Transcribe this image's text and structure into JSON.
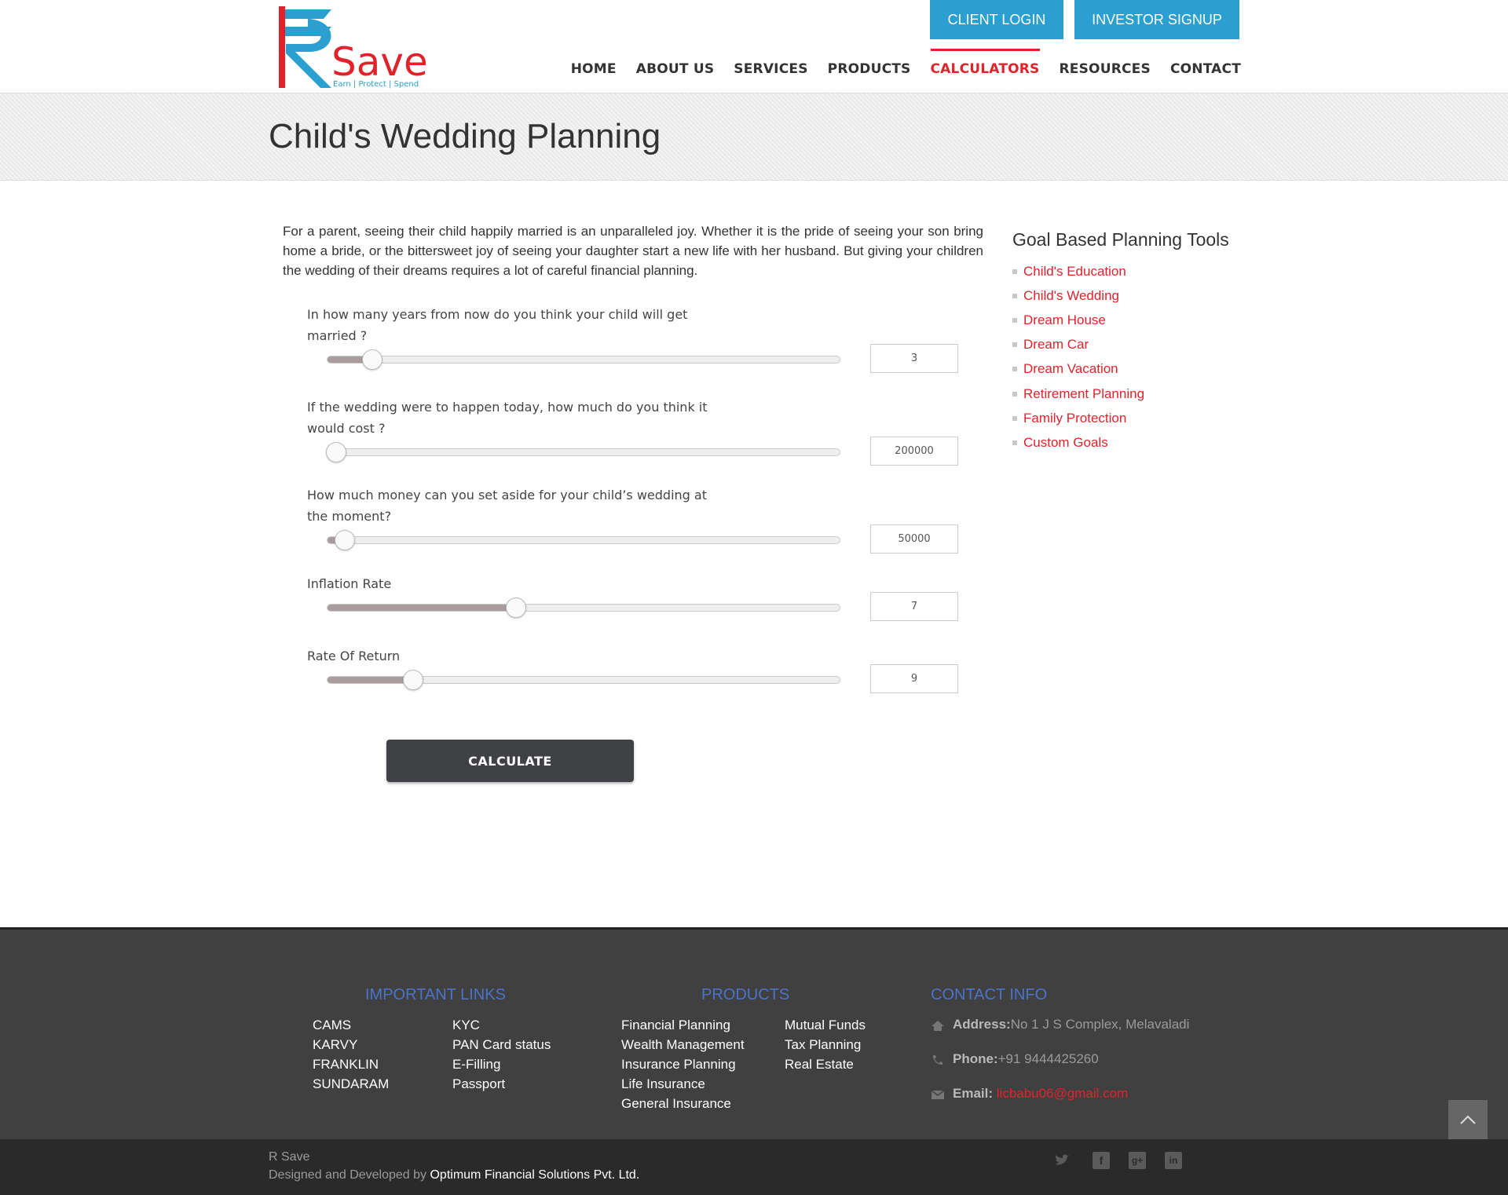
{
  "header": {
    "logo": {
      "text": "Save",
      "tagline": "Earn | Protect | Spend"
    },
    "client_login": "CLIENT LOGIN",
    "investor_signup": "INVESTOR SIGNUP",
    "nav": [
      "HOME",
      "ABOUT US",
      "SERVICES",
      "PRODUCTS",
      "CALCULATORS",
      "RESOURCES",
      "CONTACT"
    ],
    "active_nav": "CALCULATORS",
    "accent_color": "#e0232b",
    "button_color": "#2a9fd0"
  },
  "page_title": "Child's Wedding Planning",
  "intro": "For a parent, seeing their child happily married is an unparalleled joy. Whether it is the pride of seeing your son bring home a bride, or the bittersweet joy of seeing your daughter start a new life with her husband. But giving your children the wedding of their dreams requires a lot of careful financial planning.",
  "calculator": {
    "questions": [
      {
        "label": "In how many years from now do you think your child will get married ?",
        "value": "3",
        "slider_fraction": 0.087
      },
      {
        "label": "If the wedding were to happen today, how much do you think it would cost ?",
        "value": "200000",
        "slider_fraction": 0.017
      },
      {
        "label": "How much money can you set aside for your child’s wedding at the moment?",
        "value": "50000",
        "slider_fraction": 0.034
      },
      {
        "label": "Inflation Rate",
        "value": "7",
        "slider_fraction": 0.368
      },
      {
        "label": "Rate Of Return",
        "value": "9",
        "slider_fraction": 0.167
      }
    ],
    "calculate_label": "CALCULATE"
  },
  "sidebar": {
    "title": "Goal Based Planning Tools",
    "items": [
      "Child's Education",
      "Child's Wedding",
      "Dream House",
      "Dream Car",
      "Dream Vacation",
      "Retirement Planning",
      "Family Protection",
      "Custom Goals"
    ]
  },
  "footer": {
    "important_links_title": "IMPORTANT LINKS",
    "important_links_col1": [
      "CAMS",
      "KARVY",
      "FRANKLIN",
      "SUNDARAM"
    ],
    "important_links_col2": [
      "KYC",
      "PAN Card status",
      "E-Filling",
      "Passport"
    ],
    "products_title": "PRODUCTS",
    "products_col1": [
      "Financial Planning",
      "Wealth Management",
      "Insurance Planning",
      "Life Insurance",
      "General Insurance"
    ],
    "products_col2": [
      "Mutual Funds",
      "Tax Planning",
      "Real Estate"
    ],
    "contact_title": "CONTACT INFO",
    "address_label": "Address:",
    "address_value": "No 1 J S Complex, Melavaladi",
    "phone_label": "Phone:",
    "phone_value": "+91 9444425260",
    "email_label": "Email:",
    "email_value": "licbabu06@gmail.com"
  },
  "bottom": {
    "site_name": "R Save",
    "designed_by_prefix": "Designed and Developed by ",
    "designed_by_company": "Optimum Financial Solutions Pvt. Ltd.",
    "social": [
      "twitter-icon",
      "facebook-icon",
      "google-plus-icon",
      "linkedin-icon"
    ]
  }
}
